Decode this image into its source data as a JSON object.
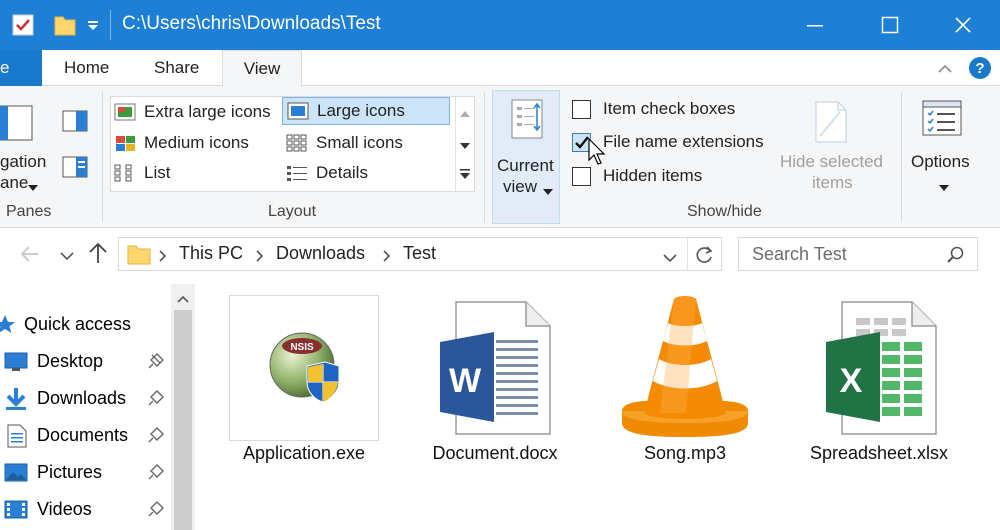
{
  "window": {
    "title": "C:\\Users\\chris\\Downloads\\Test"
  },
  "tabs": {
    "file": "e",
    "home": "Home",
    "share": "Share",
    "view": "View"
  },
  "ribbon": {
    "panes": {
      "nav_pane_line1": "gation",
      "nav_pane_line2": "ane",
      "label": "Panes"
    },
    "layout": {
      "label": "Layout",
      "items": [
        "Extra large icons",
        "Large icons",
        "Medium icons",
        "Small icons",
        "List",
        "Details"
      ],
      "selected": "Large icons"
    },
    "current_view": {
      "line1": "Current",
      "line2": "view"
    },
    "show_hide": {
      "label": "Show/hide",
      "item_check_boxes": "Item check boxes",
      "file_name_extensions": "File name extensions",
      "hidden_items": "Hidden items",
      "item_check_boxes_checked": false,
      "file_name_extensions_checked": true,
      "hidden_items_checked": false,
      "hide_selected_line1": "Hide selected",
      "hide_selected_line2": "items"
    },
    "options": {
      "label": "Options"
    }
  },
  "address": {
    "crumbs": [
      "This PC",
      "Downloads",
      "Test"
    ]
  },
  "search": {
    "placeholder": "Search Test"
  },
  "nav_pane": {
    "items": [
      {
        "label": "Quick access",
        "icon": "star-icon"
      },
      {
        "label": "Desktop",
        "icon": "desktop-icon"
      },
      {
        "label": "Downloads",
        "icon": "download-arrow-icon"
      },
      {
        "label": "Documents",
        "icon": "documents-icon"
      },
      {
        "label": "Pictures",
        "icon": "pictures-icon"
      },
      {
        "label": "Videos",
        "icon": "videos-icon"
      }
    ]
  },
  "files": [
    {
      "name": "Application.exe",
      "icon": "nsis-installer-icon",
      "selected": true
    },
    {
      "name": "Document.docx",
      "icon": "word-document-icon"
    },
    {
      "name": "Song.mp3",
      "icon": "vlc-cone-icon"
    },
    {
      "name": "Spreadsheet.xlsx",
      "icon": "excel-spreadsheet-icon"
    }
  ],
  "colors": {
    "titlebar": "#1e7fd6",
    "accent": "#1979ca",
    "ribbon_bg": "#f5f6f7",
    "selection": "#cce4f7"
  }
}
